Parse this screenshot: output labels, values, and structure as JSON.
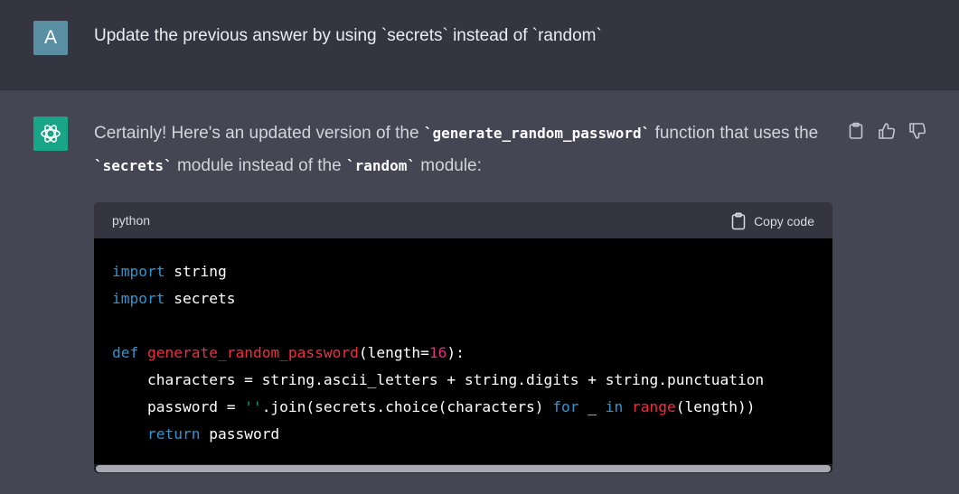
{
  "user_message": {
    "avatar_letter": "A",
    "text": "Update the previous answer by using `secrets` instead of `random`"
  },
  "assistant_message": {
    "intro_part1": "Certainly! Here's an updated version of the ",
    "code_function": "`generate_random_password`",
    "intro_part2": " function that uses the ",
    "code_secrets": "`secrets`",
    "intro_part3": " module instead of the ",
    "code_random": "`random`",
    "intro_part4": " module:"
  },
  "actions": {
    "copy_icon": "clipboard-icon",
    "thumbs_up_icon": "thumbs-up-icon",
    "thumbs_down_icon": "thumbs-down-icon"
  },
  "code_block": {
    "language": "python",
    "copy_label": "Copy code",
    "lines": [
      [
        {
          "t": "import",
          "c": "kw"
        },
        {
          "t": " string",
          "c": ""
        }
      ],
      [
        {
          "t": "import",
          "c": "kw"
        },
        {
          "t": " secrets",
          "c": ""
        }
      ],
      [],
      [
        {
          "t": "def",
          "c": "kw"
        },
        {
          "t": " ",
          "c": ""
        },
        {
          "t": "generate_random_password",
          "c": "fn"
        },
        {
          "t": "(length=",
          "c": ""
        },
        {
          "t": "16",
          "c": "num"
        },
        {
          "t": "):",
          "c": ""
        }
      ],
      [
        {
          "t": "    characters = string.ascii_letters + string.digits + string.punctuation",
          "c": ""
        }
      ],
      [
        {
          "t": "    password = ",
          "c": ""
        },
        {
          "t": "''",
          "c": "str"
        },
        {
          "t": ".join(secrets.choice(characters) ",
          "c": ""
        },
        {
          "t": "for",
          "c": "kw"
        },
        {
          "t": " _ ",
          "c": ""
        },
        {
          "t": "in",
          "c": "kw"
        },
        {
          "t": " ",
          "c": ""
        },
        {
          "t": "range",
          "c": "fn"
        },
        {
          "t": "(length))",
          "c": ""
        }
      ],
      [
        {
          "t": "    ",
          "c": ""
        },
        {
          "t": "return",
          "c": "kw"
        },
        {
          "t": " password",
          "c": ""
        }
      ]
    ]
  },
  "colors": {
    "user_bg": "#343541",
    "assistant_bg": "#444654",
    "avatar_user": "#5a8ea2",
    "avatar_bot": "#19a588"
  }
}
